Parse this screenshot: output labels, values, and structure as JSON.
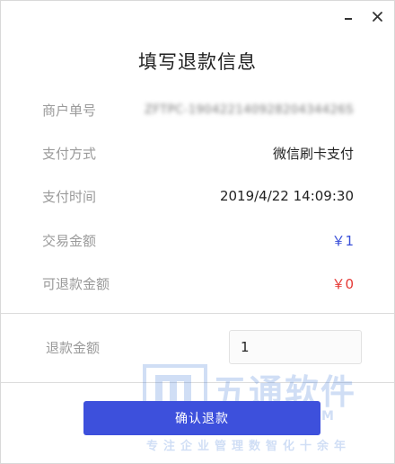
{
  "window": {
    "minimize_icon": "minimize-icon",
    "close_icon": "close-icon"
  },
  "dialog": {
    "title": "填写退款信息"
  },
  "details": [
    {
      "label": "商户单号",
      "value": "ZFTPC-19042214092820434426S",
      "style": "blurred"
    },
    {
      "label": "支付方式",
      "value": "微信刷卡支付"
    },
    {
      "label": "支付时间",
      "value": "2019/4/22 14:09:30"
    },
    {
      "label": "交易金额",
      "value": "￥1",
      "color": "#3a50d9"
    },
    {
      "label": "可退款金额",
      "value": "￥0",
      "color": "#e53935"
    }
  ],
  "refund": {
    "label": "退款金额",
    "input_value": "1"
  },
  "confirm_button": {
    "label": "确认退款",
    "color": "#3d50dc"
  },
  "watermark": {
    "name": "五通软件",
    "domain": "G.COM",
    "slogan": "专注企业管理数智化十余年"
  }
}
